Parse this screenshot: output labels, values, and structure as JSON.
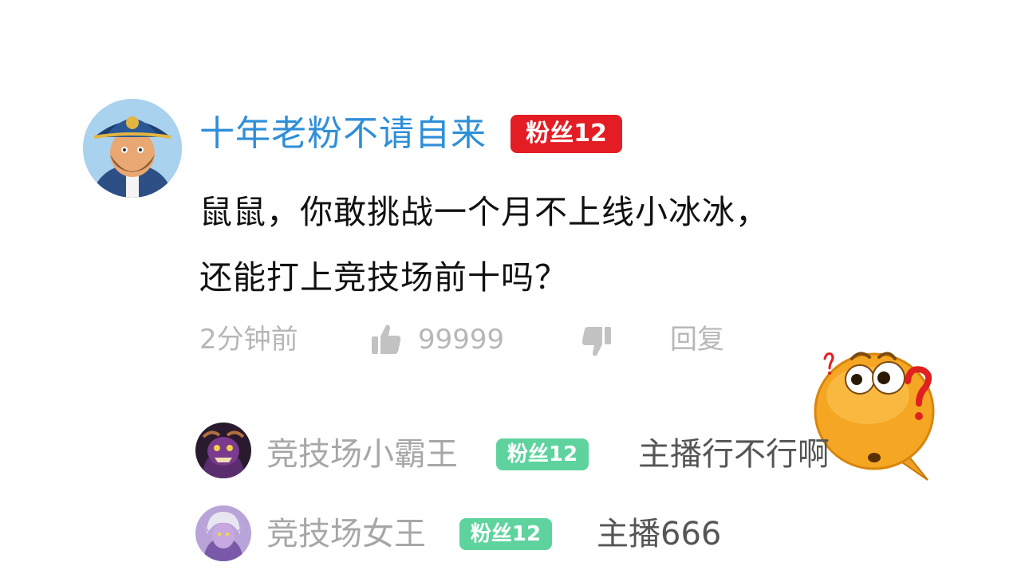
{
  "comment": {
    "username": "十年老粉不请自来",
    "badge": "粉丝12",
    "text_line1": "鼠鼠，你敢挑战一个月不上线小冰冰，",
    "text_line2": "还能打上竞技场前十吗？",
    "time": "2分钟前",
    "like_count": "99999",
    "reply_label": "回复"
  },
  "replies": [
    {
      "username": "竞技场小霸王",
      "badge": "粉丝12",
      "text": "主播行不行啊"
    },
    {
      "username": "竞技场女王",
      "badge": "粉丝12",
      "text": "主播666"
    }
  ],
  "colors": {
    "username_blue": "#2e8fd8",
    "badge_red": "#e41d24",
    "badge_green": "#5fd39e",
    "meta_gray": "#b7b7b7"
  },
  "icons": [
    "thumbs-up-icon",
    "thumbs-down-icon",
    "question-emoji-icon"
  ]
}
